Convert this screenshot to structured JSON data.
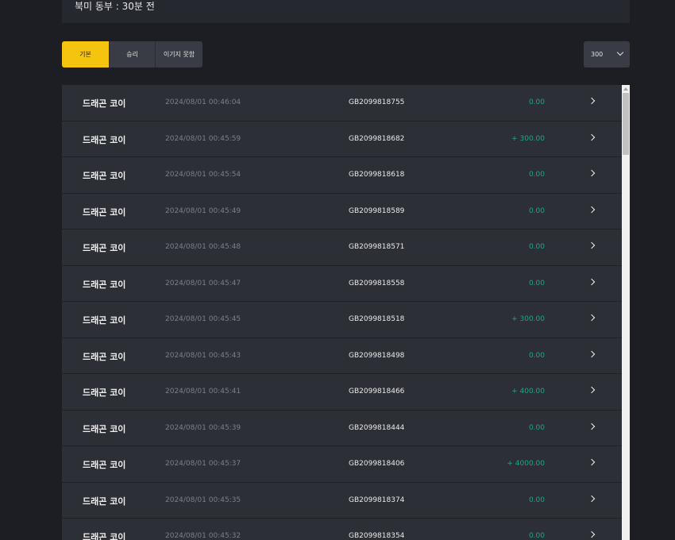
{
  "header": {
    "status_text": "북미 동부 : 30분 전"
  },
  "filters": {
    "tabs": [
      {
        "label": "기본",
        "active": true
      },
      {
        "label": "승리",
        "active": false
      },
      {
        "label": "이기지 못함",
        "active": false
      }
    ]
  },
  "page_size": {
    "selected": "300"
  },
  "colors": {
    "accent": "#f4c40f",
    "win_amount": "#19a982",
    "background": "#1c1e24",
    "row": "#2d2f37"
  },
  "rows": [
    {
      "game": "드래곤 코이",
      "time": "2024/08/01 00:46:04",
      "code": "GB2099818755",
      "amount": "0.00"
    },
    {
      "game": "드래곤 코이",
      "time": "2024/08/01 00:45:59",
      "code": "GB2099818682",
      "amount": "+ 300.00"
    },
    {
      "game": "드래곤 코이",
      "time": "2024/08/01 00:45:54",
      "code": "GB2099818618",
      "amount": "0.00"
    },
    {
      "game": "드래곤 코이",
      "time": "2024/08/01 00:45:49",
      "code": "GB2099818589",
      "amount": "0.00"
    },
    {
      "game": "드래곤 코이",
      "time": "2024/08/01 00:45:48",
      "code": "GB2099818571",
      "amount": "0.00"
    },
    {
      "game": "드래곤 코이",
      "time": "2024/08/01 00:45:47",
      "code": "GB2099818558",
      "amount": "0.00"
    },
    {
      "game": "드래곤 코이",
      "time": "2024/08/01 00:45:45",
      "code": "GB2099818518",
      "amount": "+ 300.00"
    },
    {
      "game": "드래곤 코이",
      "time": "2024/08/01 00:45:43",
      "code": "GB2099818498",
      "amount": "0.00"
    },
    {
      "game": "드래곤 코이",
      "time": "2024/08/01 00:45:41",
      "code": "GB2099818466",
      "amount": "+ 400.00"
    },
    {
      "game": "드래곤 코이",
      "time": "2024/08/01 00:45:39",
      "code": "GB2099818444",
      "amount": "0.00"
    },
    {
      "game": "드래곤 코이",
      "time": "2024/08/01 00:45:37",
      "code": "GB2099818406",
      "amount": "+ 4000.00"
    },
    {
      "game": "드래곤 코이",
      "time": "2024/08/01 00:45:35",
      "code": "GB2099818374",
      "amount": "0.00"
    },
    {
      "game": "드래곤 코이",
      "time": "2024/08/01 00:45:32",
      "code": "GB2099818354",
      "amount": "0.00"
    }
  ]
}
